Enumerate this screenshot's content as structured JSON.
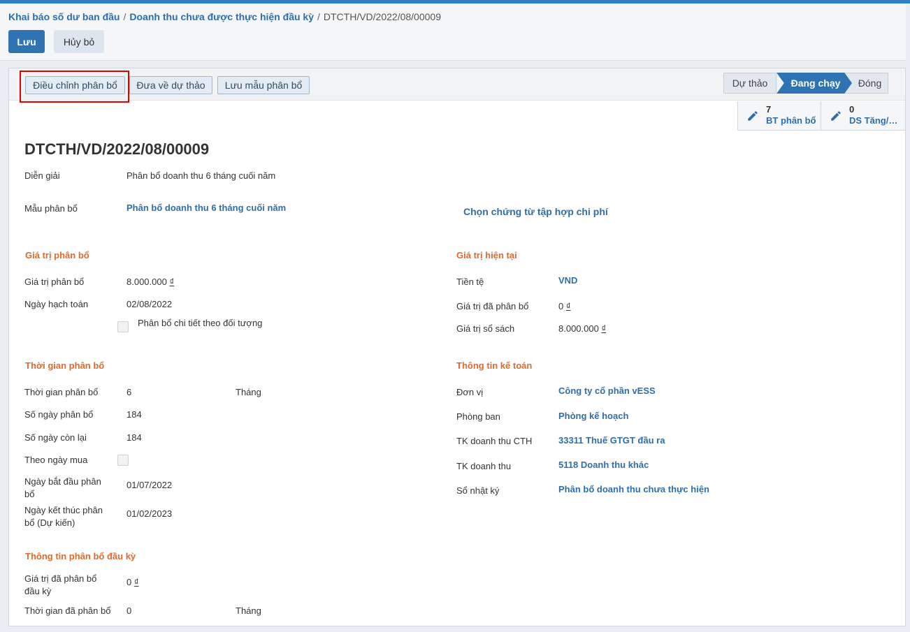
{
  "breadcrumb": {
    "item1": "Khai báo số dư ban đầu",
    "item2": "Doanh thu chưa được thực hiện đầu kỳ",
    "current": "DTCTH/VD/2022/08/00009",
    "sep": "/"
  },
  "buttons": {
    "save": "Lưu",
    "cancel": "Hủy bỏ"
  },
  "header_buttons": {
    "adjust": "Điều chỉnh phân bổ",
    "to_draft": "Đưa về dự thảo",
    "save_template": "Lưu mẫu phân bổ"
  },
  "stages": {
    "draft": "Dự thảo",
    "running": "Đang chạy",
    "closed": "Đóng"
  },
  "smart_buttons": [
    {
      "count": "7",
      "label": "BT phân bổ"
    },
    {
      "count": "0",
      "label": "DS Tăng/…"
    }
  ],
  "title": "DTCTH/VD/2022/08/00009",
  "fields": {
    "description_label": "Diễn giải",
    "description": "Phân bổ doanh thu 6 tháng cuối năm",
    "template_label": "Mẫu phân bổ",
    "template": "Phân bổ doanh thu 6 tháng cuối năm",
    "choose_link": "Chọn chứng từ tập hợp chi phí"
  },
  "alloc_value": {
    "section": "Giá trị phân bổ",
    "value_label": "Giá trị phân bổ",
    "value": "8.000.000",
    "currency_symbol": "₫",
    "date_label": "Ngày hạch toán",
    "date": "02/08/2022",
    "detail_label": "Phân bổ chi tiết theo đối tượng"
  },
  "current_value": {
    "section": "Giá trị hiện tại",
    "currency_label": "Tiền tệ",
    "currency": "VND",
    "allocated_label": "Giá trị đã phân bổ",
    "allocated": "0",
    "book_label": "Giá trị sổ sách",
    "book": "8.000.000"
  },
  "alloc_time": {
    "section": "Thời gian phân bổ",
    "period_label": "Thời gian phân bổ",
    "period": "6",
    "period_unit": "Tháng",
    "days_label": "Số ngày phân bổ",
    "days": "184",
    "remaining_label": "Số ngày còn lại",
    "remaining": "184",
    "by_purchase_label": "Theo ngày mua",
    "start_label_1": "Ngày bắt đầu phân",
    "start_label_2": "bổ",
    "start": "01/07/2022",
    "end_label_1": "Ngày kết thúc phân",
    "end_label_2": "bổ (Dự kiến)",
    "end": "01/02/2023"
  },
  "accounting": {
    "section": "Thông tin kế toán",
    "unit_label": "Đơn vị",
    "unit": "Công ty cổ phần vESS",
    "dept_label": "Phòng ban",
    "dept": "Phòng kế hoạch",
    "acc_cth_label": "TK doanh thu CTH",
    "acc_cth": "33311 Thuế GTGT đầu ra",
    "acc_label": "TK doanh thu",
    "acc": "5118 Doanh thu khác",
    "journal_label": "Sổ nhật ký",
    "journal": "Phân bổ doanh thu chưa thực hiện"
  },
  "opening": {
    "section": "Thông tin phân bổ đầu kỳ",
    "allocated_label_1": "Giá trị đã phân bổ",
    "allocated_label_2": "đầu kỳ",
    "allocated": "0",
    "time_label": "Thời gian đã phân bổ",
    "time": "0",
    "time_unit": "Tháng"
  }
}
